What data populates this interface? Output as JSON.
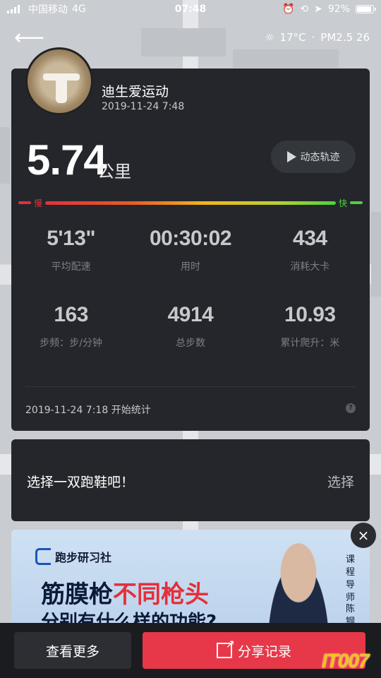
{
  "status_bar": {
    "carrier": "中国移动",
    "network": "4G",
    "time": "07:48",
    "battery_percent": "92%",
    "battery_level": 0.92
  },
  "nav": {
    "back_icon": "back-arrow-icon"
  },
  "weather": {
    "temperature": "17°C",
    "separator": "·",
    "pm25": "PM2.5 26"
  },
  "profile": {
    "username": "迪生爱运动",
    "datetime": "2019-11-24 7:48"
  },
  "summary": {
    "distance": "5.74",
    "distance_unit": "公里",
    "replay_label": "动态轨迹"
  },
  "pace_bar": {
    "slow_label": "慢",
    "fast_label": "快"
  },
  "metrics": [
    {
      "value": "5'13\"",
      "label": "平均配速"
    },
    {
      "value": "00:30:02",
      "label": "用时"
    },
    {
      "value": "434",
      "label": "消耗大卡"
    },
    {
      "value": "163",
      "label": "步频：步/分钟"
    },
    {
      "value": "4914",
      "label": "总步数"
    },
    {
      "value": "10.93",
      "label": "累计爬升：米"
    }
  ],
  "start": {
    "text": "2019-11-24 7:18 开始统计",
    "help": "?"
  },
  "shoe": {
    "prompt": "选择一双跑鞋吧！",
    "action": "选择"
  },
  "ad": {
    "brand": "跑步研习社",
    "headline_part1": "筋膜枪",
    "headline_highlight": "不同枪头",
    "subline": "分别有什么样的功能?",
    "side_text": "课程导师",
    "side_name": "陈钢",
    "close": "×"
  },
  "bottom": {
    "more_label": "查看更多",
    "share_label": "分享记录"
  },
  "watermark": "IT007",
  "colors": {
    "card": "#24262b",
    "accent_red": "#e7384a",
    "pace_slow": "#e2313b",
    "pace_fast": "#4fd13a"
  }
}
